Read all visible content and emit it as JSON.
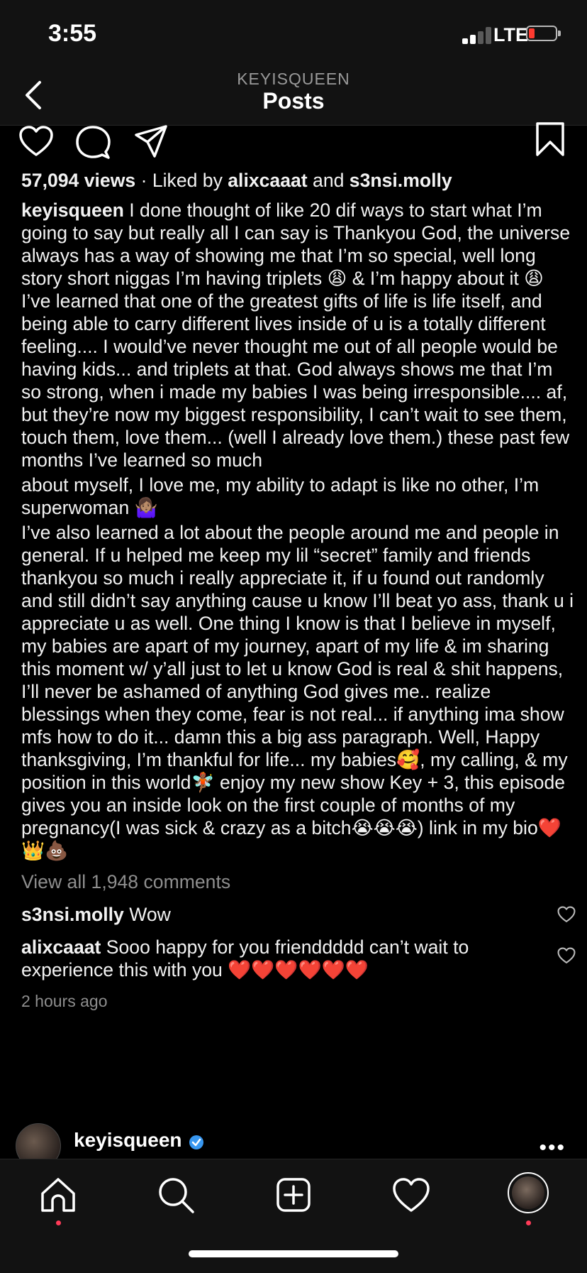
{
  "status": {
    "time": "3:55",
    "network": "LTE"
  },
  "nav": {
    "username": "KEYISQUEEN",
    "title": "Posts"
  },
  "post": {
    "views": "57,094 views",
    "liked_prefix": "· Liked by",
    "liked_user1": "alixcaaat",
    "liked_and": "and",
    "liked_user2": "s3nsi.molly",
    "caption_user": "keyisqueen",
    "caption_p1": "I done thought of like 20 dif ways to start what I’m going to say but really all I can say is Thankyou God, the universe always has a way of showing me that I’m so special, well long story short niggas I’m having triplets 😩 & I’m happy about it 😩 I’ve learned that one of the greatest gifts of life is life itself, and being able to carry different lives inside of u is a totally different feeling.... I would’ve never thought me out of all people would be having kids... and triplets at that. God always shows me that I’m so strong, when i made my babies I was being irresponsible.... af, but they’re now my biggest responsibility, I can’t wait to see them, touch them, love them... (well I already love them.) these past few months I’ve learned so much",
    "caption_p2": "about myself, I love me, my ability to adapt is like no other, I’m superwoman 🤷🏽‍♀️",
    "caption_p3": "I’ve also learned a lot about the people around me and people in general. If u helped me keep my lil “secret” family and friends thankyou so much i really appreciate it, if u found out randomly and still didn’t say anything cause u know I’ll beat yo ass, thank u i appreciate u as well. One thing I know is that I believe in myself, my babies are apart of my journey, apart of my life & im sharing this moment w/ y’all just to let u know God is real & shit happens, I’ll never be ashamed of anything God gives me.. realize blessings when they come, fear is not real... if anything ima show mfs how to do it... damn this a big ass paragraph. Well, Happy thanksgiving, I’m thankful for life... my babies🥰, my calling, & my position in this world🧚🏾 enjoy my new show Key + 3, this episode gives you an inside look on the first couple of months of my pregnancy(I was sick & crazy as a bitch😭😭😭) link in my bio❤️👑💩",
    "view_all": "View all 1,948 comments",
    "comments": [
      {
        "user": "s3nsi.molly",
        "text": "Wow"
      },
      {
        "user": "alixcaaat",
        "text": "Sooo happy for you frienddddd  can’t wait to experience this with you ❤️❤️❤️❤️❤️❤️"
      }
    ],
    "time_ago": "2 hours ago"
  },
  "next_post": {
    "username": "keyisqueen",
    "more": "•••"
  },
  "icons": {
    "back": "chevron-left-icon",
    "like": "heart-icon",
    "comment": "comment-bubble-icon",
    "share": "paper-plane-icon",
    "save": "bookmark-icon",
    "verified": "verified-badge-icon",
    "home": "home-icon",
    "search": "search-icon",
    "add": "add-post-icon",
    "activity": "heart-icon",
    "profile": "profile-avatar"
  },
  "colors": {
    "background": "#000000",
    "bar": "#121212",
    "muted": "#8e8e8e",
    "verified": "#3897f0",
    "notification": "#ff3b58",
    "battery_low": "#ff3b30"
  }
}
